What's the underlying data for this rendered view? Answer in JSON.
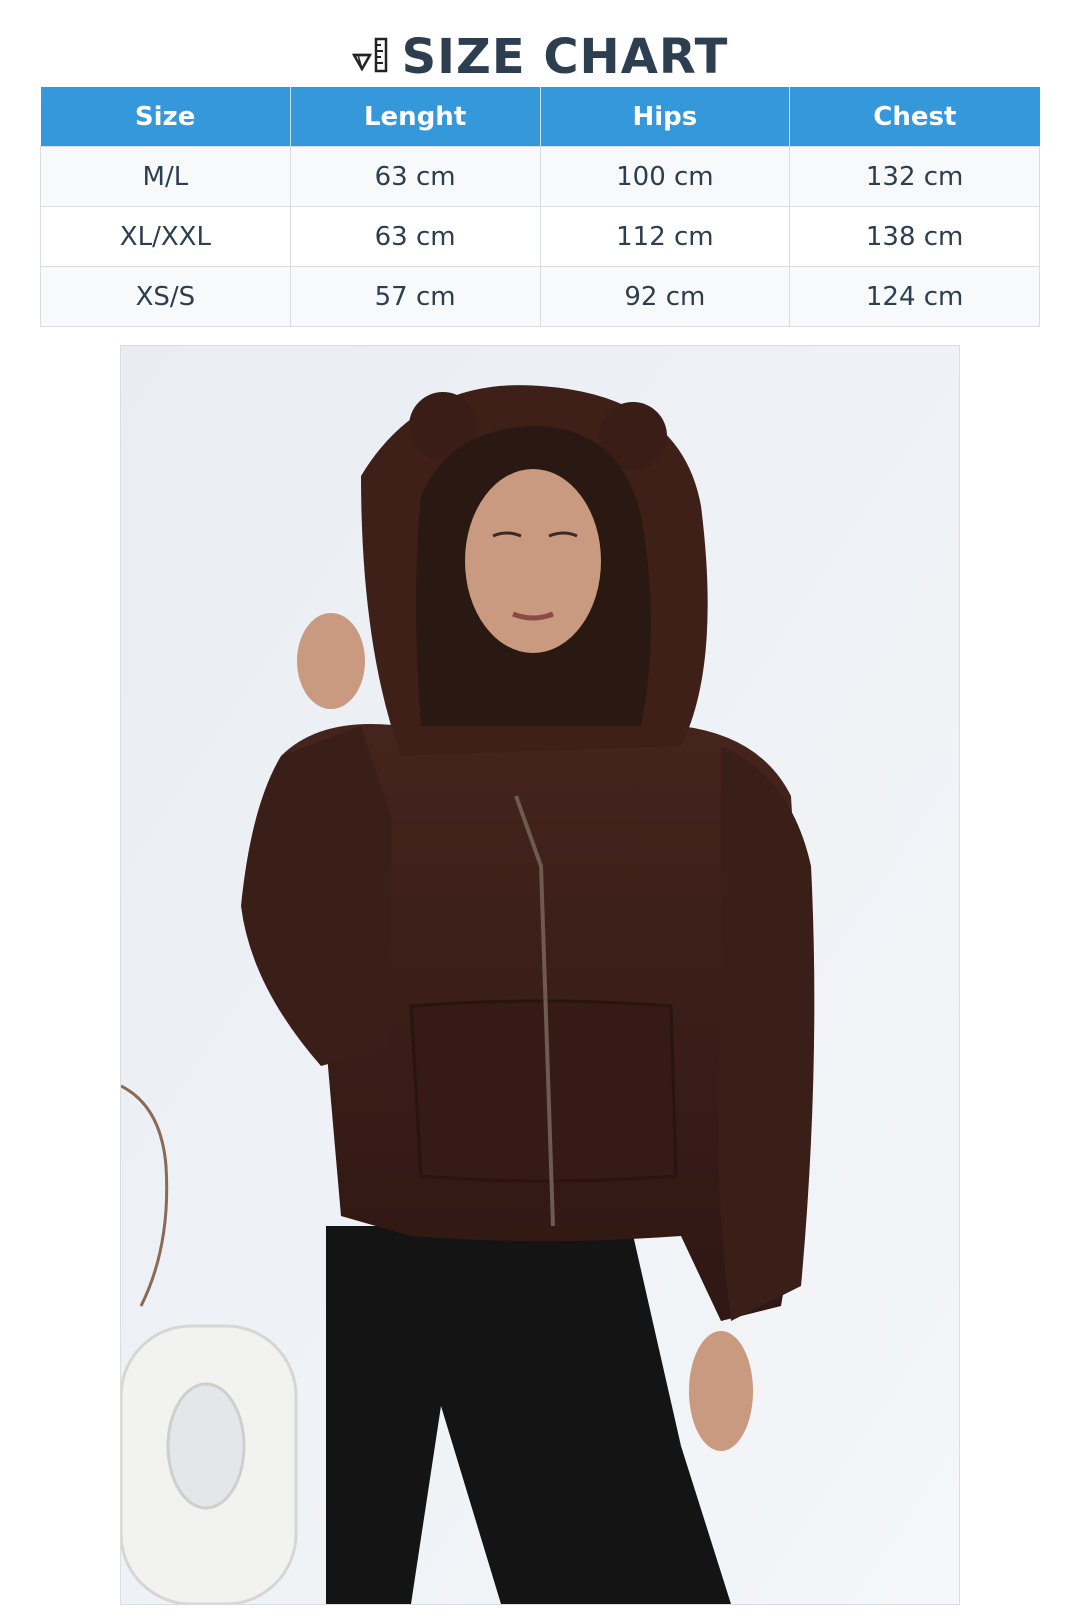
{
  "header": {
    "icon": "ruler-diamond-icon",
    "title": "SIZE CHART"
  },
  "size_table": {
    "columns": [
      "Size",
      "Lenght",
      "Hips",
      "Chest"
    ],
    "rows": [
      [
        "M/L",
        "63 cm",
        "100 cm",
        "132 cm"
      ],
      [
        "XL/XXL",
        "63 cm",
        "112 cm",
        "138 cm"
      ],
      [
        "XS/S",
        "57 cm",
        "92 cm",
        "124 cm"
      ]
    ]
  },
  "colors": {
    "title": "#2c3e50",
    "header_bg": "#3498db",
    "header_text": "#ffffff",
    "cell_text": "#2c3e50",
    "garment": "#3b1d18"
  },
  "product_photo": {
    "subject": "model wearing brown teddy-fleece hooded zip jacket with bear ears and black leggings"
  }
}
